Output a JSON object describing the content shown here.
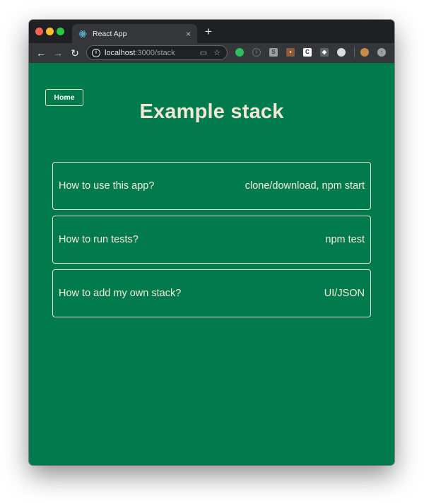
{
  "browser": {
    "tab_title": "React App",
    "tab_close": "×",
    "new_tab": "+",
    "url_host": "localhost",
    "url_path": ":3000/stack",
    "nav": {
      "back": "←",
      "forward": "→",
      "reload": "↻"
    },
    "omnibox_icons": [
      "cast-icon",
      "star-icon"
    ],
    "extensions": [
      "evernote-icon",
      "info-icon",
      "s-icon",
      "wallet-icon",
      "c-icon",
      "shield-icon",
      "circle-icon",
      "avatar",
      "update-icon"
    ]
  },
  "page": {
    "home_label": "Home",
    "title": "Example stack",
    "items": [
      {
        "question": "How to use this app?",
        "answer": "clone/download, npm start"
      },
      {
        "question": "How to run tests?",
        "answer": "npm test"
      },
      {
        "question": "How to add my own stack?",
        "answer": "UI/JSON"
      }
    ]
  },
  "colors": {
    "page_background": "#017a4d",
    "text_cream": "#f3e7d6",
    "browser_chrome": "#35363a",
    "titlebar": "#1f2023"
  }
}
